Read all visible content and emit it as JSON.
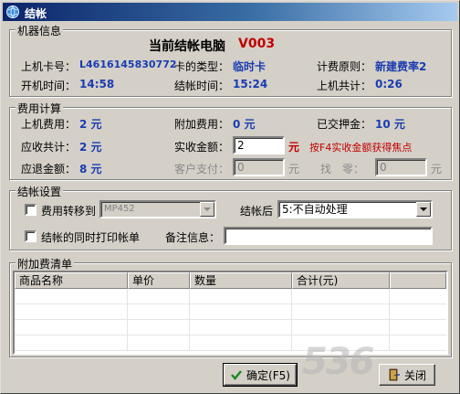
{
  "window": {
    "title": "结帐"
  },
  "machine": {
    "group_title": "机器信息",
    "heading_label": "当前结帐电脑",
    "heading_value": "V003",
    "card_no_label": "上机卡号：",
    "card_no": "L4616145830772",
    "card_type_label": "卡的类型：",
    "card_type": "临时卡",
    "billing_rule_label": "计费原则：",
    "billing_rule": "新建费率2",
    "start_time_label": "开机时间：",
    "start_time": "14:58",
    "checkout_time_label": "结帐时间：",
    "checkout_time": "15:24",
    "total_online_label": "上机共计：",
    "total_online": "0:26"
  },
  "fees": {
    "group_title": "费用计算",
    "online_fee_label": "上机费用：",
    "online_fee": "2 元",
    "extra_fee_label": "附加费用：",
    "extra_fee": "0 元",
    "deposit_label": "已交押金：",
    "deposit": "10 元",
    "receivable_label": "应收共计：",
    "receivable": "2 元",
    "actual_label": "实收金额：",
    "actual_value": "2",
    "actual_unit": "元",
    "f4_hint": "按F4实收金额获得焦点",
    "refund_label": "应退金额：",
    "refund": "8 元",
    "customer_pay_label": "客户支付：",
    "customer_pay_value": "0",
    "customer_pay_unit": "元",
    "change_label": "找　零：",
    "change_value": "0",
    "change_unit": "元"
  },
  "settings": {
    "group_title": "结帐设置",
    "transfer_label": "费用转移到",
    "transfer_target": "MP452",
    "after_label": "结帐后",
    "after_value": "5:不自动处理",
    "print_label": "结帐的同时打印帐单",
    "remark_label": "备注信息：",
    "remark_value": ""
  },
  "extra_list": {
    "group_title": "附加费清单",
    "columns": [
      "商品名称",
      "单价",
      "数量",
      "合计(元)"
    ]
  },
  "buttons": {
    "confirm": "确定(F5)",
    "close": "关闭"
  },
  "watermark": "536"
}
